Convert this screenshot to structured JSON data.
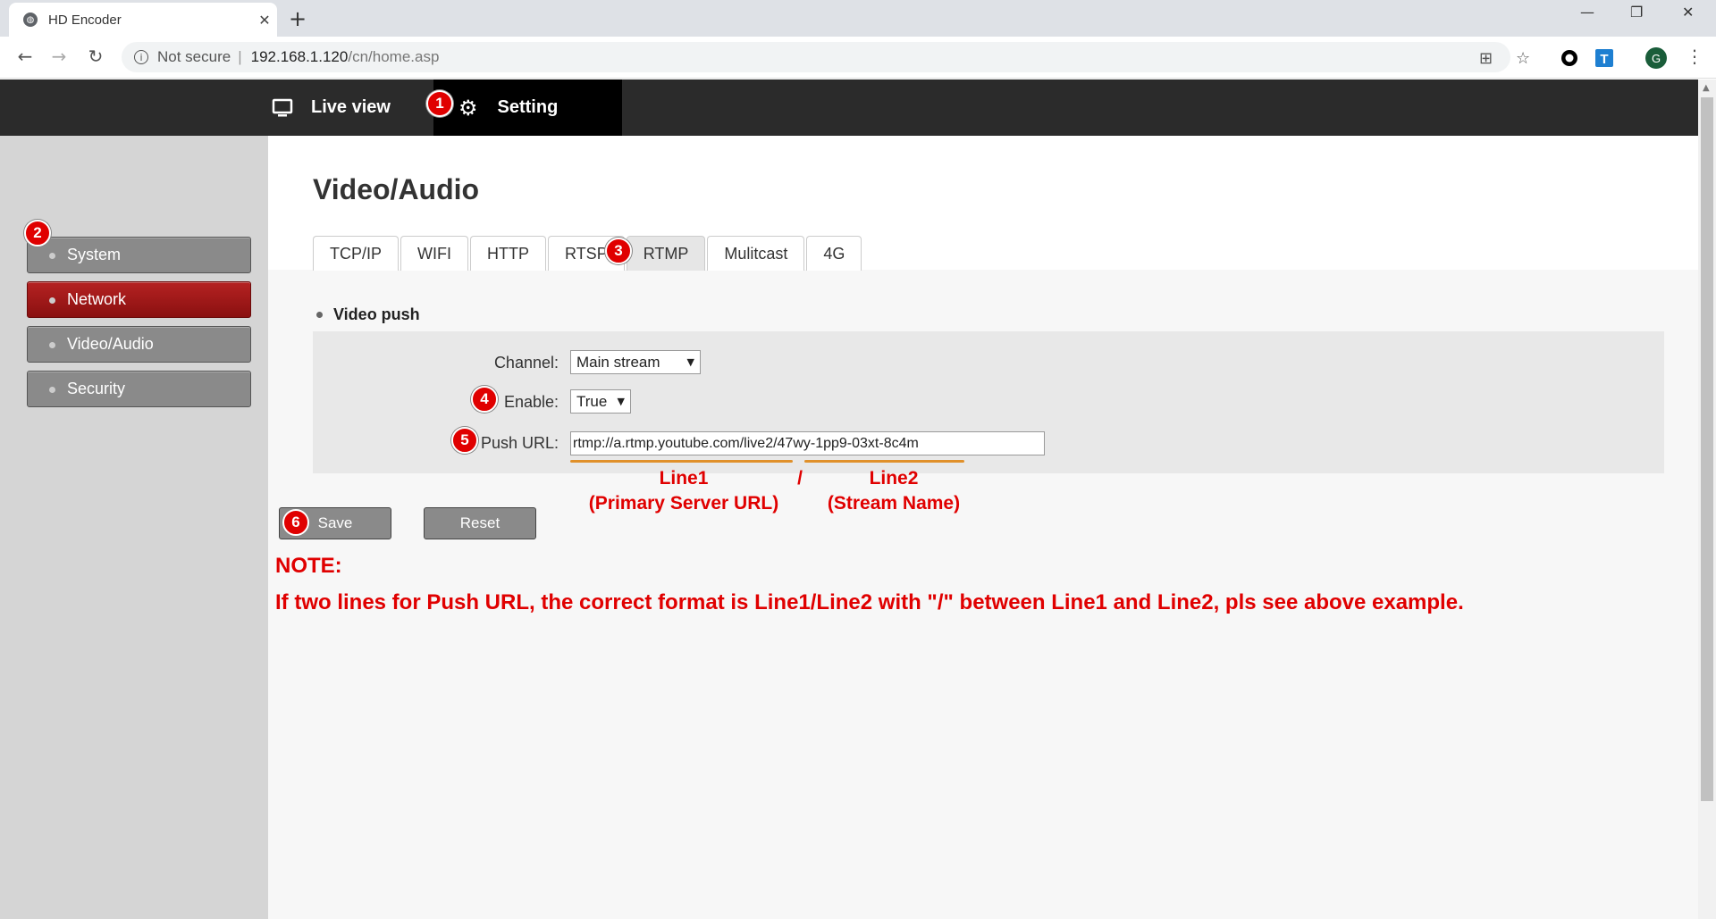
{
  "browser": {
    "tab_title": "HD Encoder",
    "tab_close": "✕",
    "new_tab": "+",
    "window_controls": [
      "—",
      "❐",
      "✕"
    ],
    "nav": {
      "back": "←",
      "forward": "→",
      "reload": "↻"
    },
    "security_label": "Not secure",
    "separator": "|",
    "url_host": "192.168.1.120",
    "url_path": "/cn/home.asp",
    "profile_initial": "G",
    "menu": "⋮"
  },
  "topnav": {
    "live_view": "Live view",
    "setting": "Setting"
  },
  "sidebar": {
    "items": [
      {
        "label": "System",
        "active": false
      },
      {
        "label": "Network",
        "active": true
      },
      {
        "label": "Video/Audio",
        "active": false
      },
      {
        "label": "Security",
        "active": false
      }
    ]
  },
  "main": {
    "title": "Video/Audio",
    "tabs": [
      "TCP/IP",
      "WIFI",
      "HTTP",
      "RTSP",
      "RTMP",
      "Mulitcast",
      "4G"
    ],
    "active_tab": "RTMP",
    "section": "Video push",
    "fields": {
      "channel_label": "Channel:",
      "channel_value": "Main stream",
      "enable_label": "Enable:",
      "enable_value": "True",
      "push_url_label": "Push URL:",
      "push_url_value": "rtmp://a.rtmp.youtube.com/live2/47wy-1pp9-03xt-8c4m"
    },
    "buttons": {
      "save": "Save",
      "reset": "Reset"
    }
  },
  "annotations": {
    "line1": "Line1",
    "line1_desc": "(Primary Server URL)",
    "slash": "/",
    "line2": "Line2",
    "line2_desc": "(Stream Name)",
    "note_title": "NOTE:",
    "note_text": "If two lines for Push URL, the correct format is Line1/Line2 with \"/\" between Line1 and Line2, pls see above example.",
    "badges": [
      "1",
      "2",
      "3",
      "4",
      "5",
      "6"
    ],
    "color": "#e00000",
    "underline_color": "#e0902a"
  },
  "colors": {
    "topbar": "#2b2b2b",
    "sidebar_item": "#8a8a8a",
    "sidebar_active": "#a81818"
  }
}
